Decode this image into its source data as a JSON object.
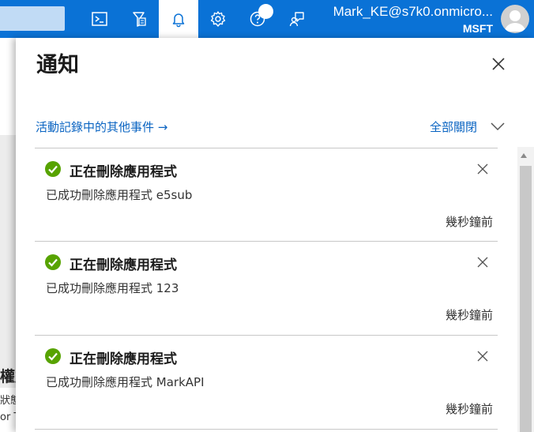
{
  "topbar": {
    "icons": [
      "cloud-shell-icon",
      "directory-filter-icon",
      "notifications-bell-icon",
      "settings-gear-icon",
      "help-icon",
      "feedback-icon"
    ],
    "user_email": "Mark_KE@s7k0.onmicro...",
    "user_org": "MSFT"
  },
  "background": {
    "text1": "權益",
    "text2": "狀態",
    "text3": "or T"
  },
  "panel": {
    "title": "通知",
    "activity_log_link": "活動記錄中的其他事件 →",
    "dismiss_all": "全部關閉"
  },
  "notifications": [
    {
      "title": "正在刪除應用程式",
      "message": "已成功刪除應用程式 e5sub",
      "time": "幾秒鐘前",
      "status": "success"
    },
    {
      "title": "正在刪除應用程式",
      "message": "已成功刪除應用程式 123",
      "time": "幾秒鐘前",
      "status": "success"
    },
    {
      "title": "正在刪除應用程式",
      "message": "已成功刪除應用程式 MarkAPI",
      "time": "幾秒鐘前",
      "status": "success"
    }
  ],
  "colors": {
    "topbar": "#0a72d6",
    "link": "#0a64c2",
    "success": "#57a300"
  }
}
